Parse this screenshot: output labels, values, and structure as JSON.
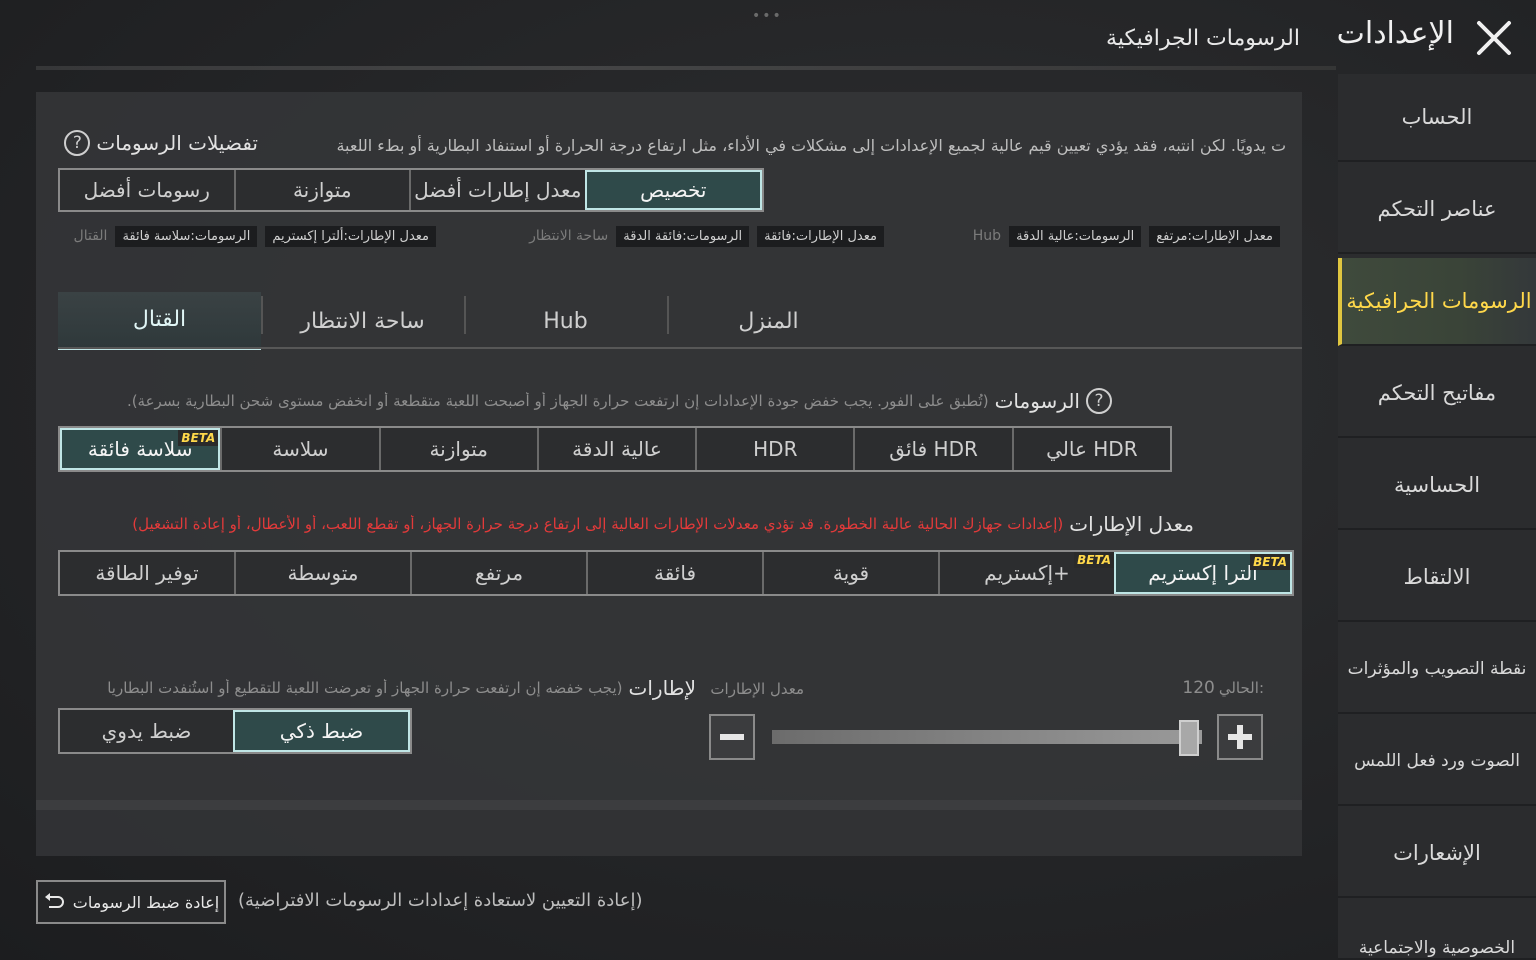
{
  "header": {
    "title": "الإعدادات",
    "subtitle": "الرسومات الجرافيكية",
    "dots": "•••"
  },
  "sidebar": {
    "items": [
      {
        "label": "الحساب"
      },
      {
        "label": "عناصر التحكم"
      },
      {
        "label": "الرسومات الجرافيكية"
      },
      {
        "label": "مفاتيح التحكم"
      },
      {
        "label": "الحساسية"
      },
      {
        "label": "الالتقاط"
      },
      {
        "label": "نقطة التصويب والمؤثرات"
      },
      {
        "label": "الصوت ورد فعل اللمس"
      },
      {
        "label": "الإشعارات"
      },
      {
        "label": "الخصوصية والاجتماعية"
      }
    ]
  },
  "preferences": {
    "title": "تفضيلات الرسومات",
    "description": "ت يدويًا. لكن انتبه، فقد يؤدي تعيين قيم عالية لجميع الإعدادات إلى مشكلات في الأداء، مثل ارتفاع درجة الحرارة أو استنفاد البطارية أو بطء اللعبة",
    "options": [
      "تخصيص",
      "معدل إطارات أفضل",
      "متوازنة",
      "رسومات أفضل"
    ],
    "selected": "تخصيص",
    "summary": [
      {
        "mode": "Hub",
        "graphics": "الرسومات:عالية الدقة",
        "fps": "معدل الإطارات:مرتفع"
      },
      {
        "mode": "ساحة الانتظار",
        "graphics": "الرسومات:فائقة الدقة",
        "fps": "معدل الإطارات:فائقة"
      },
      {
        "mode": "القتال",
        "graphics": "الرسومات:سلاسة فائقة",
        "fps": "معدل الإطارات:ألترا إكستريم"
      }
    ]
  },
  "mode_tabs": {
    "items": [
      "القتال",
      "ساحة الانتظار",
      "Hub",
      "المنزل"
    ],
    "active": "القتال"
  },
  "graphics": {
    "label": "الرسومات",
    "hint": "(تُطبق على الفور. يجب خفض جودة الإعدادات إن ارتفعت حرارة الجهاز أو أصبحت اللعبة متقطعة أو انخفض مستوى شحن البطارية بسرعة).",
    "options": [
      "سلاسة فائقة",
      "سلاسة",
      "متوازنة",
      "عالية الدقة",
      "HDR",
      "فائق HDR",
      "عالي HDR"
    ],
    "selected": "سلاسة فائقة",
    "beta": "BETA"
  },
  "frame_rate": {
    "label": "معدل الإطارات",
    "warning": "(إعدادات جهازك الحالية عالية الخطورة. قد تؤدي معدلات الإطارات العالية إلى ارتفاع درجة حرارة الجهاز، أو تقطع اللعب، أو الأعطال، أو إعادة التشغيل)",
    "options": [
      "ألترا إكستريم",
      "إكستريم+",
      "قوية",
      "فائقة",
      "مرتفع",
      "متوسطة",
      "توفير الطاقة"
    ],
    "selected": "ألترا إكستريم",
    "beta": "BETA"
  },
  "frame_control": {
    "label": "لإطارات",
    "hint": "(يجب خفضه إن ارتفعت حرارة الجهاز أو تعرضت اللعبة للتقطيع أو استُنفدت البطاريا",
    "options": [
      "ضبط ذكي",
      "ضبط يدوي"
    ],
    "selected": "ضبط ذكي",
    "slider_label": "معدل الإطارات",
    "current_label": "الحالي:",
    "current_value": "120",
    "slider_level": 0.97
  },
  "reset": {
    "button_label": "إعادة ضبط الرسومات",
    "hint": "(إعادة التعيين لاستعادة إعدادات الرسومات الافتراضية)"
  },
  "colors": {
    "accent": "#bfe6e6",
    "active_sidebar_text": "#ffd84a",
    "warning": "#e23a3a"
  }
}
